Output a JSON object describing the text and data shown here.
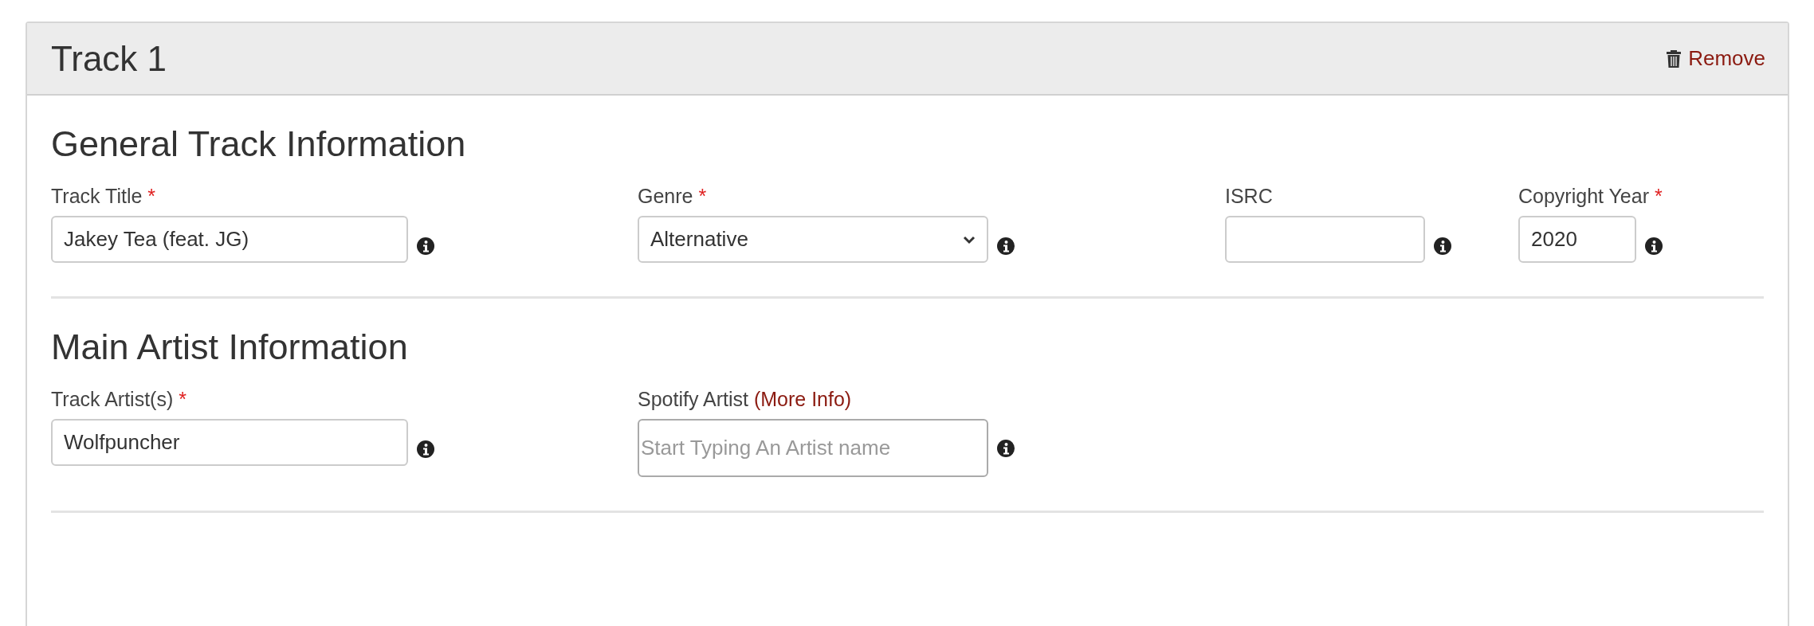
{
  "card": {
    "title": "Track 1",
    "remove_action": "Remove"
  },
  "sections": [
    {
      "title": "General Track Information",
      "fields": [
        {
          "kind": "text",
          "label": "Track Title",
          "required_mark": "*",
          "value": "Jakey Tea (feat. JG)"
        },
        {
          "kind": "select",
          "label": "Genre",
          "required_mark": "*",
          "value": "Alternative"
        },
        {
          "kind": "text",
          "label": "ISRC"
        },
        {
          "kind": "text",
          "label": "Copyright Year",
          "required_mark": "*",
          "value": "2020"
        }
      ]
    },
    {
      "title": "Main Artist Information",
      "fields": [
        {
          "kind": "text",
          "label": "Track Artist(s)",
          "required_mark": "*",
          "value": "Wolfpuncher"
        },
        {
          "kind": "search",
          "label": "Spotify Artist",
          "label_link": "(More Info)",
          "placeholder": "Start Typing An Artist name"
        }
      ]
    }
  ]
}
